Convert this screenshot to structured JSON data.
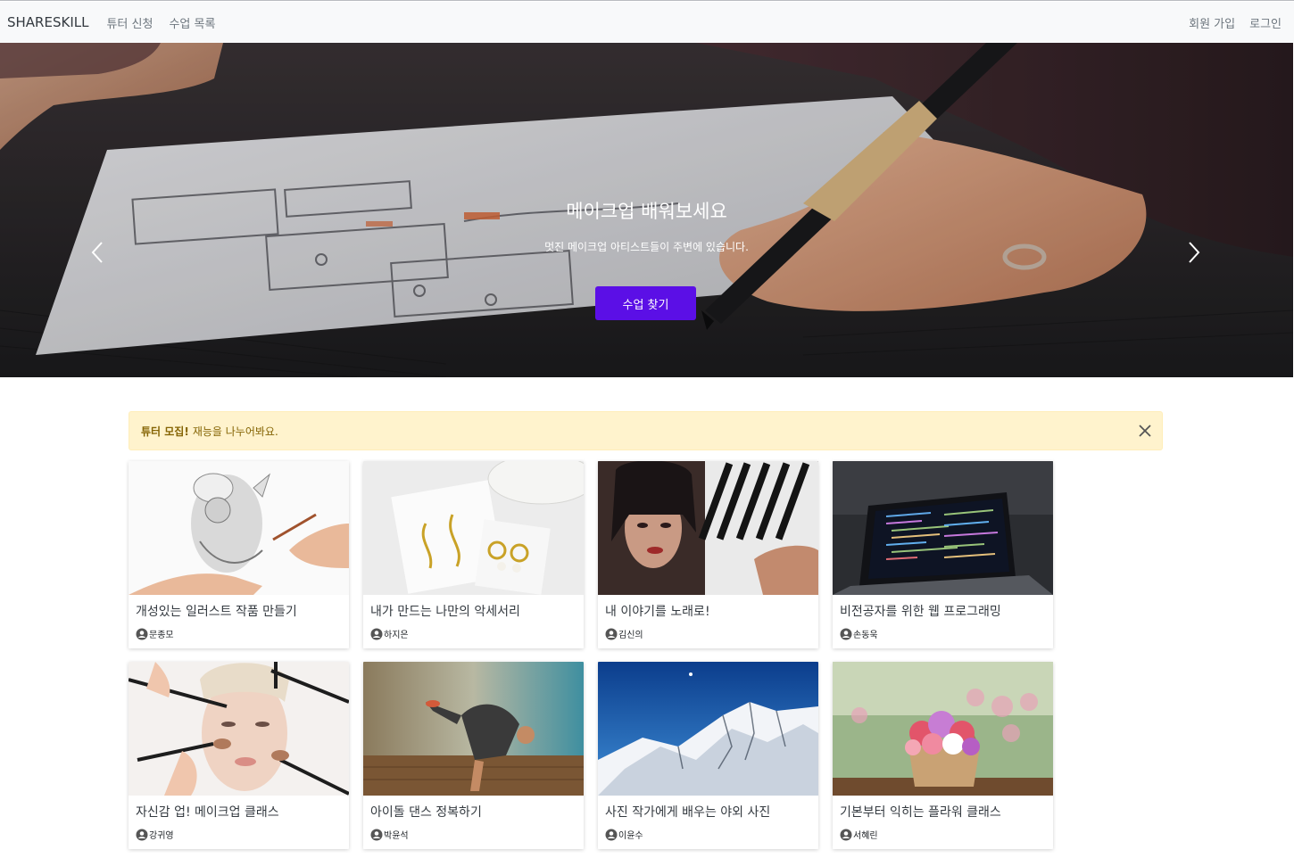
{
  "navbar": {
    "brand": "SHARESKILL",
    "links": [
      {
        "label": "튜터 신청"
      },
      {
        "label": "수업 목록"
      }
    ],
    "right_links": [
      {
        "label": "회원 가입"
      },
      {
        "label": "로그인"
      }
    ]
  },
  "hero": {
    "title": "메이크업 배워보세요",
    "subtitle": "멋진 메이크업 아티스트들이 주변에 있습니다.",
    "button_label": "수업 찾기",
    "active_slide": 2,
    "slide_count": 3,
    "button_color": "#5b0fe6"
  },
  "alert": {
    "strong": "튜터 모집!",
    "text": "재능을 나누어봐요."
  },
  "courses": [
    {
      "title": "개성있는 일러스트 작품 만들기",
      "author": "문종모"
    },
    {
      "title": "내가 만드는 나만의 악세서리",
      "author": "하지은"
    },
    {
      "title": "내 이야기를 노래로!",
      "author": "김신의"
    },
    {
      "title": "비전공자를 위한 웹 프로그래밍",
      "author": "손동욱"
    },
    {
      "title": "자신감 업! 메이크업 클래스",
      "author": "강귀영"
    },
    {
      "title": "아이돌 댄스 정복하기",
      "author": "박윤석"
    },
    {
      "title": "사진 작가에게 배우는 야외 사진",
      "author": "이윤수"
    },
    {
      "title": "기본부터 익히는 플라워 클래스",
      "author": "서혜린"
    }
  ]
}
